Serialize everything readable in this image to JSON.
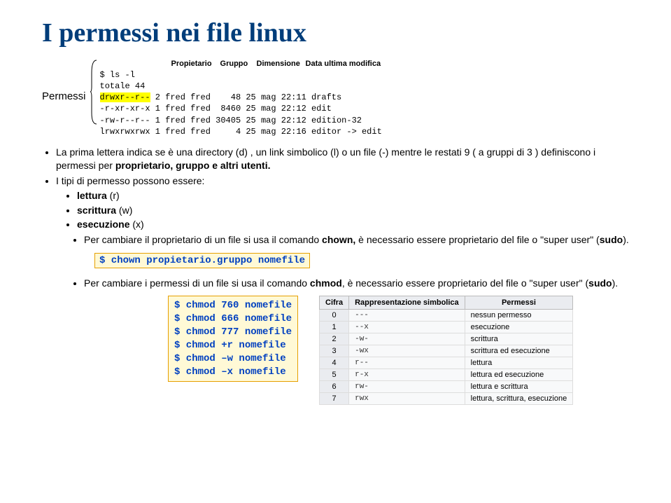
{
  "title": "I permessi nei file linux",
  "permessi_label": "Permessi",
  "ls": {
    "prompt": "$ ls -l",
    "headers": [
      "Propietario",
      "Gruppo",
      "Dimensione",
      "Data ultima modifica"
    ],
    "total": "totale 44",
    "rows": [
      {
        "perm_hl": "drwxr--r--",
        "rest": " 2 fred fred    48 25 mag 22:11 drafts"
      },
      {
        "perm_hl": "",
        "rest": "-r-xr-xr-x 1 fred fred  8460 25 mag 22:12 edit"
      },
      {
        "perm_hl": "",
        "rest": "-rw-r--r-- 1 fred fred 30405 25 mag 22:12 edition-32"
      },
      {
        "perm_hl": "",
        "rest": "lrwxrwxrwx 1 fred fred     4 25 mag 22:16 editor -> edit"
      }
    ]
  },
  "bullet1": {
    "pre": "La prima lettera indica se è una directory (d) , un link simbolico (l) o un file (-)  mentre le restati 9 ( a gruppi di 3 ) definiscono i permessi per ",
    "bold": "proprietario, gruppo e altri utenti."
  },
  "bullet2": {
    "pre": "I tipi di permesso possono essere:",
    "sub": [
      {
        "b": "lettura",
        "t": " (r)"
      },
      {
        "b": "scrittura",
        "t": " (w)"
      },
      {
        "b": "esecuzione",
        "t": " (x)"
      }
    ]
  },
  "bullet3": {
    "pre": "Per cambiare il proprietario di un file si usa il comando ",
    "bold": "chown,",
    "mid": " è necessario essere proprietario del file o \"super user\" (",
    "b2": "sudo",
    "post": ")."
  },
  "chown_cmd": "$ chown propietario.gruppo nomefile",
  "bullet4": {
    "pre": "Per cambiare i permessi di un file si usa il comando ",
    "bold": "chmod",
    "mid": ", è necessario essere proprietario del file o \"super user\" (",
    "b2": "sudo",
    "post": ")."
  },
  "chmod_cmds": [
    "$ chmod 760 nomefile",
    "$ chmod 666 nomefile",
    "$ chmod 777 nomefile",
    "$ chmod +r nomefile",
    "$ chmod –w nomefile",
    "$ chmod –x nomefile"
  ],
  "table": {
    "headers": [
      "Cifra",
      "Rappresentazione simbolica",
      "Permessi"
    ],
    "rows": [
      [
        "0",
        "---",
        "nessun permesso"
      ],
      [
        "1",
        "--x",
        "esecuzione"
      ],
      [
        "2",
        "-w-",
        "scrittura"
      ],
      [
        "3",
        "-wx",
        "scrittura ed esecuzione"
      ],
      [
        "4",
        "r--",
        "lettura"
      ],
      [
        "5",
        "r-x",
        "lettura ed esecuzione"
      ],
      [
        "6",
        "rw-",
        "lettura e scrittura"
      ],
      [
        "7",
        "rwx",
        "lettura, scrittura, esecuzione"
      ]
    ]
  }
}
